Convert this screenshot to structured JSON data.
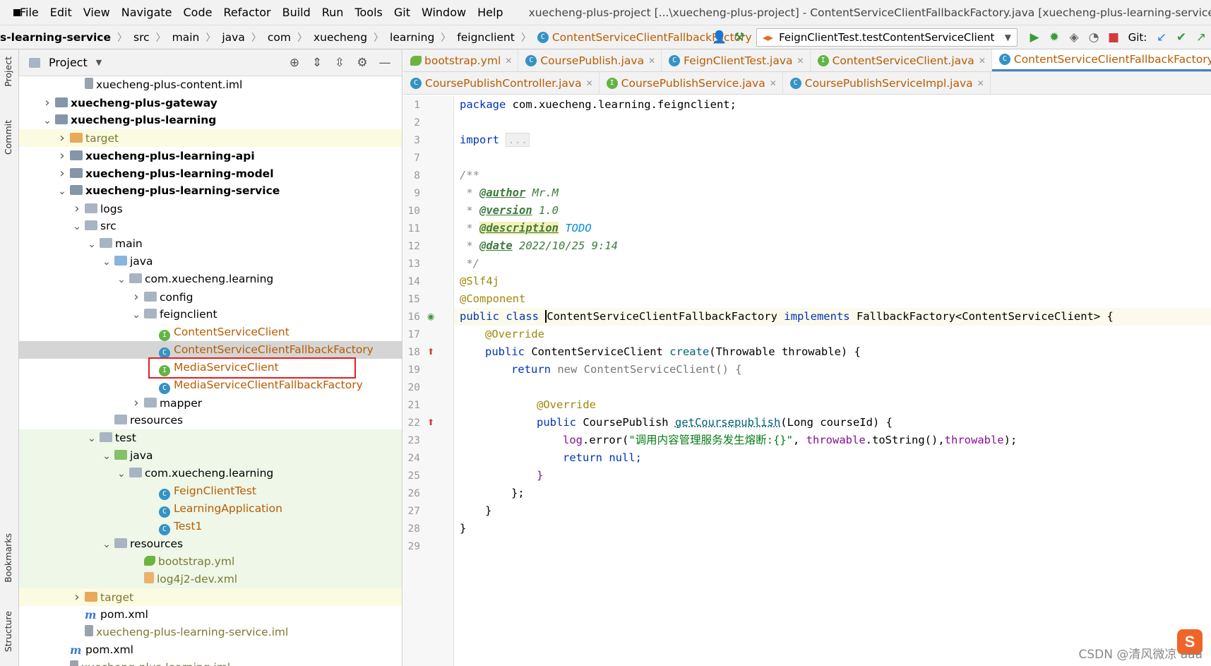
{
  "menubar": {
    "items": [
      "File",
      "Edit",
      "View",
      "Navigate",
      "Code",
      "Refactor",
      "Build",
      "Run",
      "Tools",
      "Git",
      "Window",
      "Help"
    ],
    "window_title": "xuecheng-plus-project [...\\xuecheng-plus-project] - ContentServiceClientFallbackFactory.java [xuecheng-plus-learning-service]"
  },
  "navbar": {
    "crumbs": [
      "s-learning-service",
      "src",
      "main",
      "java",
      "com",
      "xuecheng",
      "learning",
      "feignclient",
      "ContentServiceClientFallbackFactory"
    ],
    "run_config": "FeignClientTest.testContentServiceClient",
    "git_label": "Git:"
  },
  "leftstrip": {
    "project_tab": "Project",
    "commit_tab": "Commit",
    "bookmarks_tab": "Bookmarks",
    "structure_tab": "Structure"
  },
  "project": {
    "title": "Project",
    "tree": [
      {
        "label": "xuecheng-plus-content.iml",
        "type": "iml",
        "depth": 3,
        "bg": "",
        "arrow": ""
      },
      {
        "label": "xuecheng-plus-gateway",
        "type": "module",
        "depth": 1,
        "bg": "",
        "arrow": "right",
        "bold": true
      },
      {
        "label": "xuecheng-plus-learning",
        "type": "module",
        "depth": 1,
        "bg": "",
        "arrow": "down",
        "bold": true
      },
      {
        "label": "target",
        "type": "folder-orange",
        "depth": 2,
        "bg": "yellow",
        "arrow": "right",
        "color": "mod"
      },
      {
        "label": "xuecheng-plus-learning-api",
        "type": "module",
        "depth": 2,
        "bg": "",
        "arrow": "right",
        "bold": true
      },
      {
        "label": "xuecheng-plus-learning-model",
        "type": "module",
        "depth": 2,
        "bg": "",
        "arrow": "right",
        "bold": true
      },
      {
        "label": "xuecheng-plus-learning-service",
        "type": "module",
        "depth": 2,
        "bg": "",
        "arrow": "down",
        "bold": true
      },
      {
        "label": "logs",
        "type": "folder",
        "depth": 3,
        "bg": "",
        "arrow": "right"
      },
      {
        "label": "src",
        "type": "folder",
        "depth": 3,
        "bg": "",
        "arrow": "down"
      },
      {
        "label": "main",
        "type": "folder",
        "depth": 4,
        "bg": "",
        "arrow": "down"
      },
      {
        "label": "java",
        "type": "folder-blue",
        "depth": 5,
        "bg": "",
        "arrow": "down"
      },
      {
        "label": "com.xuecheng.learning",
        "type": "folder",
        "depth": 6,
        "bg": "",
        "arrow": "down"
      },
      {
        "label": "config",
        "type": "folder",
        "depth": 7,
        "bg": "",
        "arrow": "right"
      },
      {
        "label": "feignclient",
        "type": "folder",
        "depth": 7,
        "bg": "",
        "arrow": "down"
      },
      {
        "label": "ContentServiceClient",
        "type": "interface",
        "depth": 8,
        "bg": "",
        "arrow": "",
        "color": "orange"
      },
      {
        "label": "ContentServiceClientFallbackFactory",
        "type": "class",
        "depth": 8,
        "bg": "sel",
        "arrow": "",
        "color": "orange"
      },
      {
        "label": "MediaServiceClient",
        "type": "interface",
        "depth": 8,
        "bg": "",
        "arrow": "",
        "color": "orange"
      },
      {
        "label": "MediaServiceClientFallbackFactory",
        "type": "class",
        "depth": 8,
        "bg": "",
        "arrow": "",
        "color": "orange"
      },
      {
        "label": "mapper",
        "type": "folder",
        "depth": 7,
        "bg": "",
        "arrow": "right"
      },
      {
        "label": "resources",
        "type": "folder",
        "depth": 5,
        "bg": "",
        "arrow": ""
      },
      {
        "label": "test",
        "type": "folder",
        "depth": 4,
        "bg": "green",
        "arrow": "down"
      },
      {
        "label": "java",
        "type": "folder-green",
        "depth": 5,
        "bg": "green",
        "arrow": "down"
      },
      {
        "label": "com.xuecheng.learning",
        "type": "folder",
        "depth": 6,
        "bg": "green",
        "arrow": "down"
      },
      {
        "label": "FeignClientTest",
        "type": "class",
        "depth": 8,
        "bg": "green",
        "arrow": "",
        "color": "orange"
      },
      {
        "label": "LearningApplication",
        "type": "class",
        "depth": 8,
        "bg": "green",
        "arrow": "",
        "color": "orange"
      },
      {
        "label": "Test1",
        "type": "class",
        "depth": 8,
        "bg": "green",
        "arrow": "",
        "color": "orange"
      },
      {
        "label": "resources",
        "type": "folder",
        "depth": 5,
        "bg": "green",
        "arrow": "down"
      },
      {
        "label": "bootstrap.yml",
        "type": "yml",
        "depth": 7,
        "bg": "green",
        "arrow": "",
        "color": "mod"
      },
      {
        "label": "log4j2-dev.xml",
        "type": "xml",
        "depth": 7,
        "bg": "green",
        "arrow": "",
        "color": "mod"
      },
      {
        "label": "target",
        "type": "folder-orange",
        "depth": 3,
        "bg": "yellow",
        "arrow": "right",
        "color": "mod"
      },
      {
        "label": "pom.xml",
        "type": "pom",
        "depth": 3,
        "bg": "",
        "arrow": ""
      },
      {
        "label": "xuecheng-plus-learning-service.iml",
        "type": "iml",
        "depth": 3,
        "bg": "",
        "arrow": "",
        "color": "mod"
      },
      {
        "label": "pom.xml",
        "type": "pom",
        "depth": 2,
        "bg": "",
        "arrow": ""
      },
      {
        "label": "xuecheng-plus-learning.iml",
        "type": "iml",
        "depth": 2,
        "bg": "",
        "arrow": "",
        "color": "mod"
      }
    ]
  },
  "editor": {
    "tabs_row1": [
      {
        "label": "bootstrap.yml",
        "icon": "yml",
        "active": false
      },
      {
        "label": "CoursePublish.java",
        "icon": "C",
        "active": false
      },
      {
        "label": "FeignClientTest.java",
        "icon": "C",
        "active": false
      },
      {
        "label": "ContentServiceClient.java",
        "icon": "I",
        "active": false
      },
      {
        "label": "ContentServiceClientFallbackFactory.java",
        "icon": "C",
        "active": true
      }
    ],
    "tabs_row2": [
      {
        "label": "CoursePublishController.java",
        "icon": "C"
      },
      {
        "label": "CoursePublishService.java",
        "icon": "I"
      },
      {
        "label": "CoursePublishServiceImpl.java",
        "icon": "C"
      }
    ],
    "line_numbers": [
      "1",
      "2",
      "3",
      "7",
      "8",
      "9",
      "10",
      "11",
      "12",
      "13",
      "14",
      "15",
      "16",
      "17",
      "18",
      "19",
      "20",
      "21",
      "22",
      "23",
      "24",
      "25",
      "26",
      "27",
      "28",
      "29"
    ],
    "code": {
      "l1": "package com.xuecheng.learning.feignclient;",
      "l3_kw": "import",
      "l3_fold": "...",
      "l8": "/**",
      "l9_tag": "@author",
      "l9_val": " Mr.M",
      "l10_tag": "@version",
      "l10_val": " 1.0",
      "l11_tag": "@description",
      "l11_val": "TODO",
      "l12_tag": "@date",
      "l12_val": " 2022/10/25 9:14",
      "l13": " */",
      "l14": "@Slf4j",
      "l15": "@Component",
      "l16_a": "public class ",
      "l16_b": "ContentServiceClientFallbackFactory",
      "l16_c": " implements ",
      "l16_d": "FallbackFactory<ContentServiceClient>",
      "l16_e": " {",
      "l17": "@Override",
      "l18_a": "public ",
      "l18_b": "ContentServiceClient ",
      "l18_c": "create",
      "l18_d": "(Throwable throwable) {",
      "l19_a": "return ",
      "l19_b": "new ContentServiceClient() {",
      "l21": "@Override",
      "l22_a": "public ",
      "l22_b": "CoursePublish ",
      "l22_c": "getCoursepublish",
      "l22_d": "(Long courseId) {",
      "l23_a": "log",
      "l23_b": ".error(",
      "l23_c": "\"调用内容管理服务发生熔断:{}\"",
      "l23_d": ", ",
      "l23_e": "throwable",
      "l23_f": ".toString(),",
      "l23_g": "throwable",
      "l23_h": ");",
      "l24_a": "return ",
      "l24_b": "null;",
      "l25": "}",
      "l26": "};",
      "l27": "}",
      "l28": "}"
    },
    "watermark": "CSDN @清风微凉 aaa",
    "sogou_logo": "S"
  }
}
